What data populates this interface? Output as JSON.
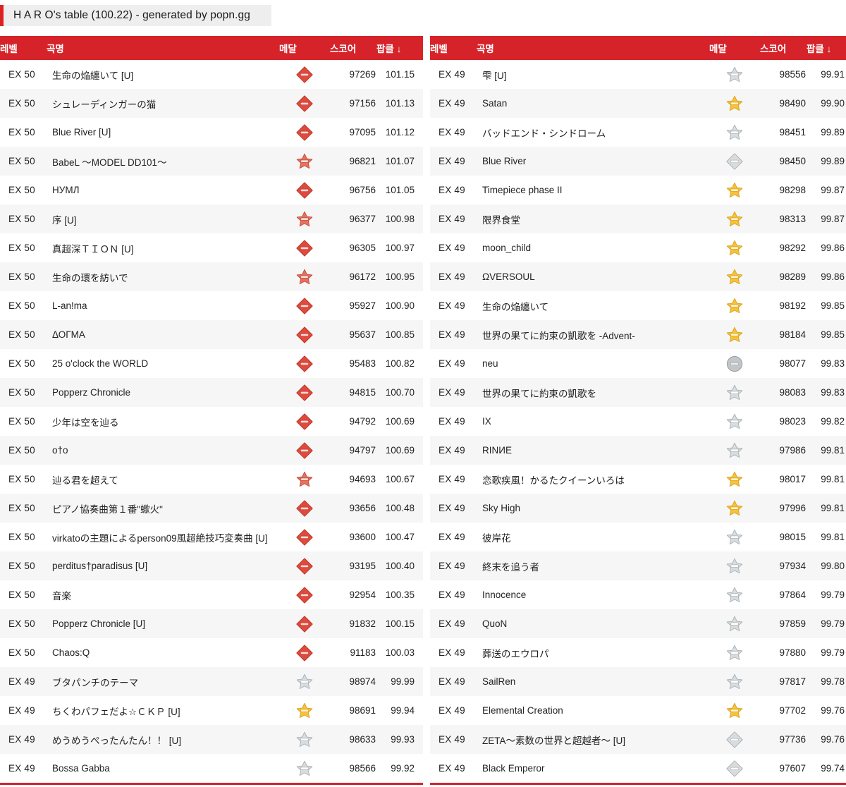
{
  "header": {
    "title": "H A R O's table (100.22) - generated by popn.gg",
    "accent_color": "#dd2222"
  },
  "table": {
    "header_bg": "#d6232a",
    "columns": {
      "level": "레벨",
      "title": "곡명",
      "medal": "메달",
      "score": "스코어",
      "rate": "팝클 ↓"
    }
  },
  "medal_colors": {
    "red": "#e0493c",
    "gold": "#f5c23a",
    "silver": "#c9ccce",
    "gray": "#b6b9bb"
  },
  "left_rows": [
    {
      "level": "EX 50",
      "title": "生命の焔纏いて [U]",
      "medal": "red-diamond-medal",
      "score": "97269",
      "rate": "101.15"
    },
    {
      "level": "EX 50",
      "title": "シュレーディンガーの猫",
      "medal": "red-diamond-medal",
      "score": "97156",
      "rate": "101.13"
    },
    {
      "level": "EX 50",
      "title": "Blue River [U]",
      "medal": "red-diamond-medal",
      "score": "97095",
      "rate": "101.12"
    },
    {
      "level": "EX 50",
      "title": "BabeL 〜MODEL DD101〜",
      "medal": "red-star-medal",
      "score": "96821",
      "rate": "101.07"
    },
    {
      "level": "EX 50",
      "title": "НУМЛ",
      "medal": "red-diamond-medal",
      "score": "96756",
      "rate": "101.05"
    },
    {
      "level": "EX 50",
      "title": "序 [U]",
      "medal": "red-star-medal",
      "score": "96377",
      "rate": "100.98"
    },
    {
      "level": "EX 50",
      "title": "真超深ＴＩＯＮ [U]",
      "medal": "red-diamond-medal",
      "score": "96305",
      "rate": "100.97"
    },
    {
      "level": "EX 50",
      "title": "生命の環を紡いで",
      "medal": "red-star-medal",
      "score": "96172",
      "rate": "100.95"
    },
    {
      "level": "EX 50",
      "title": "L-an!ma",
      "medal": "red-diamond-medal",
      "score": "95927",
      "rate": "100.90"
    },
    {
      "level": "EX 50",
      "title": "ΔΟΓΜΑ",
      "medal": "red-diamond-medal",
      "score": "95637",
      "rate": "100.85"
    },
    {
      "level": "EX 50",
      "title": "25 o'clock the WORLD",
      "medal": "red-diamond-medal",
      "score": "95483",
      "rate": "100.82"
    },
    {
      "level": "EX 50",
      "title": "Popperz Chronicle",
      "medal": "red-diamond-medal",
      "score": "94815",
      "rate": "100.70"
    },
    {
      "level": "EX 50",
      "title": "少年は空を辿る",
      "medal": "red-diamond-medal",
      "score": "94792",
      "rate": "100.69"
    },
    {
      "level": "EX 50",
      "title": "o†o",
      "medal": "red-diamond-medal",
      "score": "94797",
      "rate": "100.69"
    },
    {
      "level": "EX 50",
      "title": "辿る君を超えて",
      "medal": "red-star-medal",
      "score": "94693",
      "rate": "100.67"
    },
    {
      "level": "EX 50",
      "title": "ピアノ協奏曲第１番\"蠍火\"",
      "medal": "red-diamond-medal",
      "score": "93656",
      "rate": "100.48"
    },
    {
      "level": "EX 50",
      "title": "virkatoの主題によるperson09風超絶技巧変奏曲 [U]",
      "medal": "red-diamond-medal",
      "score": "93600",
      "rate": "100.47"
    },
    {
      "level": "EX 50",
      "title": "perditus†paradisus [U]",
      "medal": "red-diamond-medal",
      "score": "93195",
      "rate": "100.40"
    },
    {
      "level": "EX 50",
      "title": "音楽",
      "medal": "red-diamond-medal",
      "score": "92954",
      "rate": "100.35"
    },
    {
      "level": "EX 50",
      "title": "Popperz Chronicle [U]",
      "medal": "red-diamond-medal",
      "score": "91832",
      "rate": "100.15"
    },
    {
      "level": "EX 50",
      "title": "Chaos:Q",
      "medal": "red-diamond-medal",
      "score": "91183",
      "rate": "100.03"
    },
    {
      "level": "EX 49",
      "title": "ブタパンチのテーマ",
      "medal": "silver-star-medal",
      "score": "98974",
      "rate": "99.99"
    },
    {
      "level": "EX 49",
      "title": "ちくわパフェだよ☆ＣＫＰ [U]",
      "medal": "gold-star-medal",
      "score": "98691",
      "rate": "99.94"
    },
    {
      "level": "EX 49",
      "title": "めうめうぺったんたん！！ [U]",
      "medal": "silver-star-medal",
      "score": "98633",
      "rate": "99.93"
    },
    {
      "level": "EX 49",
      "title": "Bossa Gabba",
      "medal": "silver-star-medal",
      "score": "98566",
      "rate": "99.92"
    }
  ],
  "right_rows": [
    {
      "level": "EX 49",
      "title": "雫 [U]",
      "medal": "silver-star-medal",
      "score": "98556",
      "rate": "99.91"
    },
    {
      "level": "EX 49",
      "title": "Satan",
      "medal": "gold-star-medal",
      "score": "98490",
      "rate": "99.90"
    },
    {
      "level": "EX 49",
      "title": "バッドエンド・シンドローム",
      "medal": "silver-star-medal",
      "score": "98451",
      "rate": "99.89"
    },
    {
      "level": "EX 49",
      "title": "Blue River",
      "medal": "silver-diamond-medal",
      "score": "98450",
      "rate": "99.89"
    },
    {
      "level": "EX 49",
      "title": "Timepiece phase II",
      "medal": "gold-star-medal",
      "score": "98298",
      "rate": "99.87"
    },
    {
      "level": "EX 49",
      "title": "限界食堂",
      "medal": "gold-star-medal",
      "score": "98313",
      "rate": "99.87"
    },
    {
      "level": "EX 49",
      "title": "moon_child",
      "medal": "gold-star-medal",
      "score": "98292",
      "rate": "99.86"
    },
    {
      "level": "EX 49",
      "title": "ΩVERSOUL",
      "medal": "gold-star-medal",
      "score": "98289",
      "rate": "99.86"
    },
    {
      "level": "EX 49",
      "title": "生命の焔纏いて",
      "medal": "gold-star-medal",
      "score": "98192",
      "rate": "99.85"
    },
    {
      "level": "EX 49",
      "title": "世界の果てに約束の凱歌を -Advent-",
      "medal": "gold-star-medal",
      "score": "98184",
      "rate": "99.85"
    },
    {
      "level": "EX 49",
      "title": "neu",
      "medal": "gray-circle-medal",
      "score": "98077",
      "rate": "99.83"
    },
    {
      "level": "EX 49",
      "title": "世界の果てに約束の凱歌を",
      "medal": "silver-star-medal",
      "score": "98083",
      "rate": "99.83"
    },
    {
      "level": "EX 49",
      "title": "IX",
      "medal": "silver-star-medal",
      "score": "98023",
      "rate": "99.82"
    },
    {
      "level": "EX 49",
      "title": "RINИE",
      "medal": "silver-star-medal",
      "score": "97986",
      "rate": "99.81"
    },
    {
      "level": "EX 49",
      "title": "恋歌疾風！かるたクイーンいろは",
      "medal": "gold-star-medal",
      "score": "98017",
      "rate": "99.81"
    },
    {
      "level": "EX 49",
      "title": "Sky High",
      "medal": "gold-star-medal",
      "score": "97996",
      "rate": "99.81"
    },
    {
      "level": "EX 49",
      "title": "彼岸花",
      "medal": "silver-star-medal",
      "score": "98015",
      "rate": "99.81"
    },
    {
      "level": "EX 49",
      "title": "終末を追う者",
      "medal": "silver-star-medal",
      "score": "97934",
      "rate": "99.80"
    },
    {
      "level": "EX 49",
      "title": "Innocence",
      "medal": "silver-star-medal",
      "score": "97864",
      "rate": "99.79"
    },
    {
      "level": "EX 49",
      "title": "QuoN",
      "medal": "silver-star-medal",
      "score": "97859",
      "rate": "99.79"
    },
    {
      "level": "EX 49",
      "title": "葬送のエウロパ",
      "medal": "silver-star-medal",
      "score": "97880",
      "rate": "99.79"
    },
    {
      "level": "EX 49",
      "title": "SailRen",
      "medal": "silver-star-medal",
      "score": "97817",
      "rate": "99.78"
    },
    {
      "level": "EX 49",
      "title": "Elemental Creation",
      "medal": "gold-star-medal",
      "score": "97702",
      "rate": "99.76"
    },
    {
      "level": "EX 49",
      "title": "ZETA〜素数の世界と超越者〜 [U]",
      "medal": "silver-diamond-medal",
      "score": "97736",
      "rate": "99.76"
    },
    {
      "level": "EX 49",
      "title": "Black Emperor",
      "medal": "silver-diamond-medal",
      "score": "97607",
      "rate": "99.74"
    }
  ]
}
